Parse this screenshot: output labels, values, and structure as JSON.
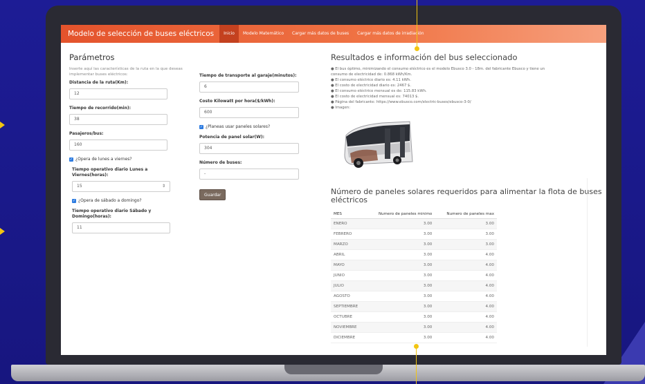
{
  "navbar": {
    "brand": "Modelo de selección de buses eléctricos",
    "links": [
      "Inicio",
      "Modelo Matemático",
      "Cargar más datos de buses",
      "Cargar más datos de irradiación"
    ]
  },
  "params": {
    "title": "Parámetros",
    "help": "Inserte aquí las características de la ruta en la que deseas implementar buses eléctricos:",
    "distancia_label": "Distancia de la ruta(Km):",
    "distancia_value": "12",
    "recorrido_label": "Tiempo de recorrido(min):",
    "recorrido_value": "38",
    "pasajeros_label": "Pasajeros/bus:",
    "pasajeros_value": "160",
    "lunes_check": "¿Opera de lunes a viernes?",
    "lunes_label": "Tiempo operativo diario Lunes a Viernes(horas):",
    "lunes_value": "15",
    "sabado_check": "¿Opera de sábado a domingo?",
    "sabado_label": "Tiempo operativo diario Sábado y Domingo(horas):",
    "sabado_value": "11",
    "garaje_label": "Tiempo de transporte al garaje(minutos):",
    "garaje_value": "6",
    "costo_label": "Costo Kilowatt por hora($/kWh):",
    "costo_value": "600",
    "solar_check": "¿Planeas usar paneles solares?",
    "potencia_label": "Potencia de panel solar(W):",
    "potencia_value": "304",
    "buses_label": "Número de buses:",
    "buses_value": "-",
    "guardar": "Guardar"
  },
  "results": {
    "title": "Resultados e información del bus seleccionado",
    "bullets": [
      "● El bus óptimo, minimizando el consumo eléctrico es el modelo Ebusco 3.0 - 18m. del fabricante Ebusco y tiene un consumo de electricidad de: 0.868 kWh/Km.",
      "● El consumo eléctrico diario es: 4.11 kWh.",
      "● El costo de electricidad diario es: 2467 $.",
      "● El consumo eléctrico mensual es de: 115.83 kWh.",
      "● El costo de electricidad mensual es: 74013 $.",
      "● Página del fabricante: https://www.ebusco.com/electric-buses/ebusco-3-0/",
      "● Imagen:"
    ],
    "panel_title": "Número de paneles solares requeridos para alimentar la flota de buses eléctricos",
    "table_headers": [
      "MES",
      "Numero de paneles minimo",
      "Numero de paneles max"
    ],
    "table_rows": [
      [
        "ENERO",
        "3.00",
        "3.00"
      ],
      [
        "FEBRERO",
        "3.00",
        "3.00"
      ],
      [
        "MARZO",
        "3.00",
        "3.00"
      ],
      [
        "ABRIL",
        "3.00",
        "4.00"
      ],
      [
        "MAYO",
        "3.00",
        "4.00"
      ],
      [
        "JUNIO",
        "3.00",
        "4.00"
      ],
      [
        "JULIO",
        "3.00",
        "4.00"
      ],
      [
        "AGOSTO",
        "3.00",
        "4.00"
      ],
      [
        "SEPTIEMBRE",
        "3.00",
        "4.00"
      ],
      [
        "OCTUBRE",
        "3.00",
        "4.00"
      ],
      [
        "NOVIEMBRE",
        "3.00",
        "4.00"
      ],
      [
        "DICIEMBRE",
        "3.00",
        "4.00"
      ]
    ]
  },
  "colors": {
    "navbar": "#e4532c",
    "active": "#c4411f",
    "marker": "#f2c511",
    "background": "#1b1a8e"
  }
}
